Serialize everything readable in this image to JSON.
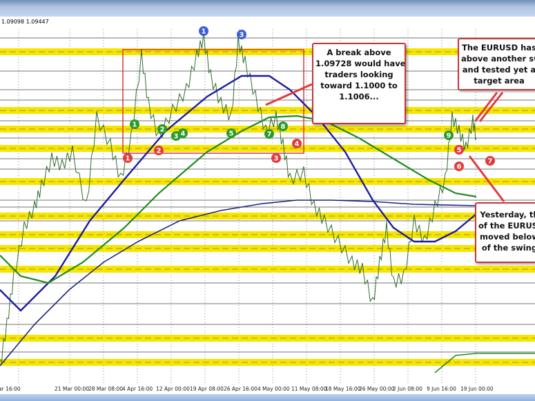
{
  "window": {
    "ohlc_readout": "1.09098 1.09447"
  },
  "time_axis": [
    "ar 16:00",
    "21 Mar 00:00",
    "28 Mar 08:00",
    "4 Apr 16:00",
    "12 Apr 00:00",
    "19 Apr 08:00",
    "26 Apr 16:00",
    "4 May 00:00",
    "11 May 08:00",
    "18 May 16:00",
    "26 May 00:00",
    "2 Jun 08:00",
    "9 Jun 16:00",
    "19 Jun 00:00"
  ],
  "annotations": {
    "break_callout": [
      "A break above",
      "1.09728 would have",
      "traders looking",
      "toward 1.1000 to",
      "1.1006..."
    ],
    "top_right_callout": [
      "The EURUSD has",
      "above another sw",
      "and tested yet a",
      "target area"
    ],
    "bottom_right_callout": [
      "Yesterday, th",
      "of the EURUSD",
      "moved below",
      "of the swing"
    ]
  },
  "colors": {
    "band": "#f5e600",
    "ma_blue": "#1c1c9c",
    "ma_green": "#1e8a1e",
    "ma_navy_thin": "#1a237e",
    "price": "#2e6b2e",
    "red": "#e23b3b",
    "green_marker": "#2a9a2a",
    "blue_marker": "#3b5fd8"
  },
  "chart_data": {
    "type": "line",
    "title": "EURUSD",
    "xlabel": "",
    "ylabel": "",
    "ylim": [
      1.051,
      1.102
    ],
    "x_unit": "bar index",
    "series": [
      {
        "name": "price",
        "color": "#2e6b2e",
        "x": [
          0,
          2,
          4,
          7,
          10,
          12,
          15,
          18,
          21,
          25,
          28,
          32,
          35,
          38,
          41,
          43,
          46,
          50,
          54,
          57,
          59,
          61,
          64,
          67,
          69,
          71,
          74,
          77,
          80,
          82,
          84,
          88,
          91,
          94,
          98,
          102,
          105,
          108,
          110,
          112,
          114,
          117,
          120,
          123,
          126,
          129,
          131,
          133,
          135,
          137,
          138
        ],
        "y": [
          1.052,
          1.058,
          1.065,
          1.072,
          1.075,
          1.078,
          1.082,
          1.081,
          1.083,
          1.075,
          1.088,
          1.084,
          1.079,
          1.085,
          1.097,
          1.09,
          1.085,
          1.089,
          1.092,
          1.097,
          1.0995,
          1.094,
          1.09,
          1.088,
          1.099,
          1.096,
          1.091,
          1.086,
          1.088,
          1.084,
          1.079,
          1.08,
          1.075,
          1.073,
          1.07,
          1.067,
          1.066,
          1.061,
          1.067,
          1.072,
          1.064,
          1.065,
          1.073,
          1.07,
          1.075,
          1.079,
          1.088,
          1.086,
          1.0835,
          1.0875,
          1.085
        ]
      },
      {
        "name": "MA blue",
        "color": "#1c1c9c",
        "x": [
          0,
          6,
          16,
          26,
          36,
          48,
          60,
          70,
          78,
          84,
          92,
          100,
          108,
          114,
          120,
          126,
          132,
          138
        ],
        "y": [
          1.063,
          1.06,
          1.065,
          1.073,
          1.079,
          1.086,
          1.091,
          1.094,
          1.094,
          1.092,
          1.088,
          1.083,
          1.076,
          1.072,
          1.07,
          1.07,
          1.0715,
          1.074
        ]
      },
      {
        "name": "MA green",
        "color": "#1e8a1e",
        "x": [
          0,
          6,
          14,
          24,
          36,
          46,
          60,
          70,
          78,
          86,
          94,
          104,
          114,
          124,
          132,
          138
        ],
        "y": [
          1.068,
          1.065,
          1.064,
          1.067,
          1.072,
          1.077,
          1.083,
          1.086,
          1.088,
          1.0882,
          1.0875,
          1.085,
          1.082,
          1.079,
          1.077,
          1.0765
        ]
      },
      {
        "name": "MA navy thin",
        "color": "#1a237e",
        "x": [
          0,
          10,
          20,
          30,
          40,
          52,
          64,
          76,
          86,
          96,
          108,
          120,
          138,
          155
        ],
        "y": [
          1.052,
          1.058,
          1.063,
          1.067,
          1.07,
          1.073,
          1.0745,
          1.0755,
          1.076,
          1.076,
          1.0758,
          1.0754,
          1.0752,
          1.0752
        ]
      },
      {
        "name": "MA green lower",
        "color": "#1e8a1e",
        "x": [
          126,
          132,
          138,
          155
        ],
        "y": [
          1.051,
          1.0535,
          1.0538,
          1.0538
        ]
      }
    ],
    "bands": [
      1.0975,
      1.089,
      1.0863,
      1.0835,
      1.0787,
      1.0737,
      1.071,
      1.069,
      1.066,
      1.056,
      1.0525
    ],
    "lines": [
      1.0995,
      1.0947,
      1.092,
      1.0905,
      1.0875,
      1.085,
      1.082,
      1.0805,
      1.076,
      1.075,
      1.073,
      1.064,
      1.061,
      1.058,
      1.054
    ],
    "markers": [
      {
        "label": "1",
        "color": "blue",
        "x": 59,
        "y": 1.1005
      },
      {
        "label": "3",
        "color": "blue",
        "x": 70,
        "y": 1.1
      },
      {
        "label": "1",
        "color": "green",
        "x": 39,
        "y": 1.087
      },
      {
        "label": "2",
        "color": "green",
        "x": 47,
        "y": 1.0863
      },
      {
        "label": "3",
        "color": "green",
        "x": 51,
        "y": 1.0853
      },
      {
        "label": "4",
        "color": "green",
        "x": 53,
        "y": 1.0857
      },
      {
        "label": "5",
        "color": "green",
        "x": 67,
        "y": 1.0857
      },
      {
        "label": "7",
        "color": "green",
        "x": 78,
        "y": 1.0856
      },
      {
        "label": "8",
        "color": "green",
        "x": 82,
        "y": 1.0867
      },
      {
        "label": "9",
        "color": "green",
        "x": 130,
        "y": 1.0854
      },
      {
        "label": "1",
        "color": "red",
        "x": 37,
        "y": 1.0821
      },
      {
        "label": "2",
        "color": "red",
        "x": 46,
        "y": 1.0832
      },
      {
        "label": "3",
        "color": "red",
        "x": 80,
        "y": 1.0821
      },
      {
        "label": "4",
        "color": "red",
        "x": 86,
        "y": 1.0842
      },
      {
        "label": "5",
        "color": "red",
        "x": 133,
        "y": 1.0833
      },
      {
        "label": "6",
        "color": "red",
        "x": 133,
        "y": 1.0809
      },
      {
        "label": "7",
        "color": "red",
        "x": 142,
        "y": 1.0817
      }
    ]
  }
}
